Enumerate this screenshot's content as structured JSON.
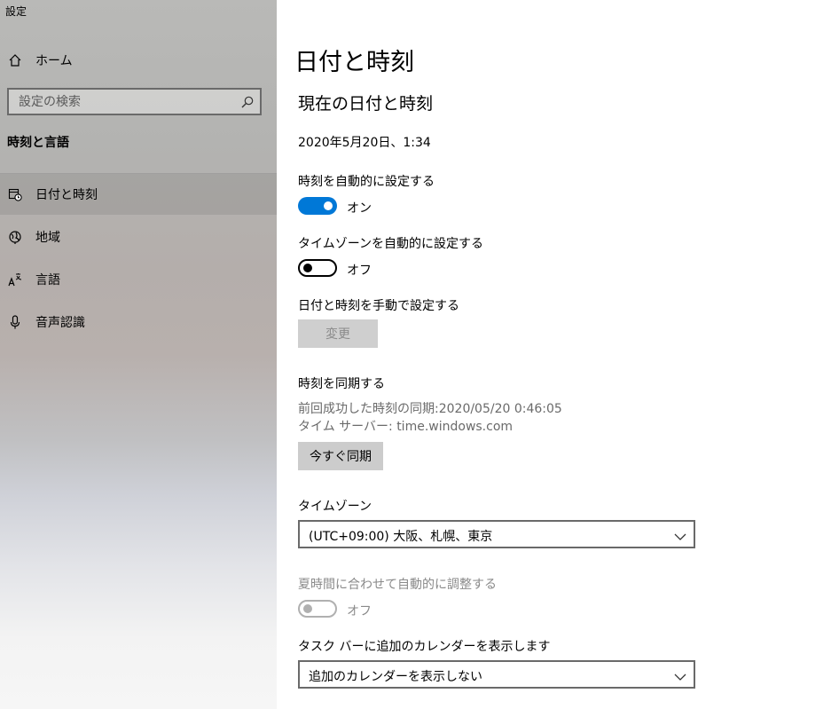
{
  "app": {
    "title": "設定"
  },
  "sidebar": {
    "home_label": "ホーム",
    "search_placeholder": "設定の検索",
    "section_heading": "時刻と言語",
    "items": [
      {
        "label": "日付と時刻",
        "icon": "calendar-clock-icon",
        "selected": true
      },
      {
        "label": "地域",
        "icon": "globe-icon",
        "selected": false
      },
      {
        "label": "言語",
        "icon": "language-icon",
        "selected": false
      },
      {
        "label": "音声認識",
        "icon": "microphone-icon",
        "selected": false
      }
    ]
  },
  "main": {
    "page_title": "日付と時刻",
    "current_heading": "現在の日付と時刻",
    "current_datetime": "2020年5月20日、1:34",
    "auto_time": {
      "label": "時刻を自動的に設定する",
      "state": "オン",
      "on": true
    },
    "auto_timezone": {
      "label": "タイムゾーンを自動的に設定する",
      "state": "オフ",
      "on": false
    },
    "manual": {
      "label": "日付と時刻を手動で設定する",
      "button": "変更",
      "enabled": false
    },
    "sync": {
      "heading": "時刻を同期する",
      "last_sync": "前回成功した時刻の同期:2020/05/20 0:46:05",
      "server": "タイム サーバー: time.windows.com",
      "button": "今すぐ同期"
    },
    "timezone": {
      "label": "タイムゾーン",
      "value": "(UTC+09:00) 大阪、札幌、東京"
    },
    "dst": {
      "label": "夏時間に合わせて自動的に調整する",
      "state": "オフ",
      "enabled": false
    },
    "calendar": {
      "label": "タスク バーに追加のカレンダーを表示します",
      "value": "追加のカレンダーを表示しない"
    }
  },
  "colors": {
    "accent": "#0078d7",
    "button_bg": "#cccccc",
    "disabled_text": "#8a8a8a"
  }
}
